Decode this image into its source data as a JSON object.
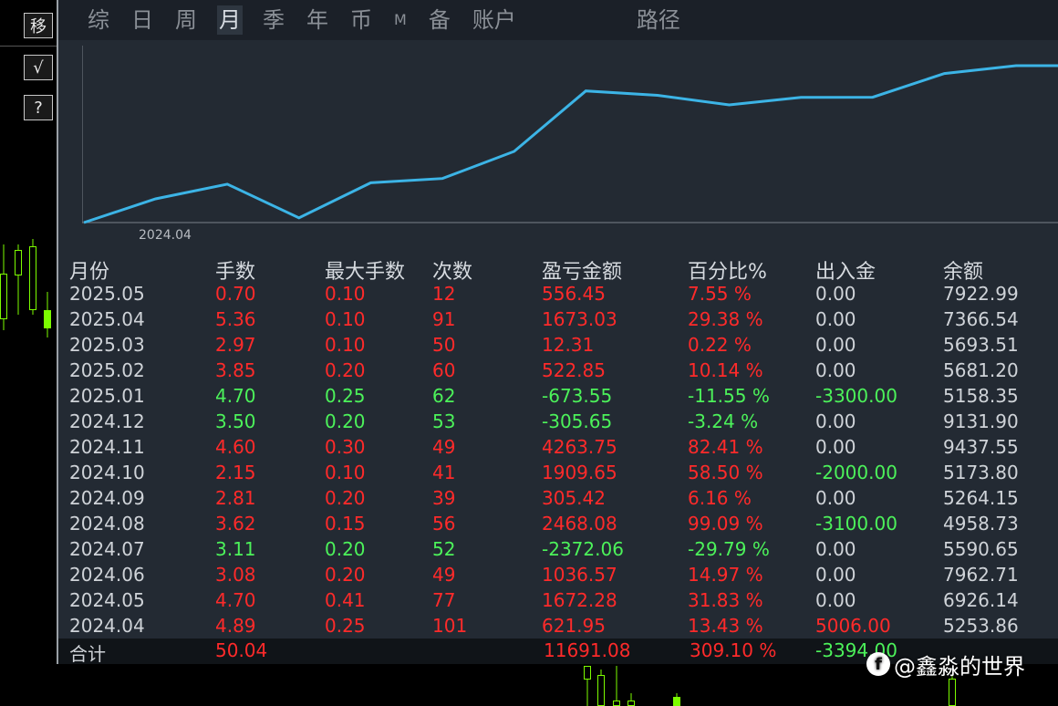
{
  "toolbar": {
    "move_label": "移",
    "check_label": "√",
    "help_label": "?"
  },
  "tabs": [
    {
      "label": "综"
    },
    {
      "label": "日"
    },
    {
      "label": "周"
    },
    {
      "label": "月"
    },
    {
      "label": "季"
    },
    {
      "label": "年"
    },
    {
      "label": "币"
    },
    {
      "label": "M"
    },
    {
      "label": "备"
    },
    {
      "label": "账户"
    },
    {
      "label": "路径"
    }
  ],
  "active_tab": "月",
  "chart_data": {
    "type": "line",
    "x": [
      "2024.04",
      "2024.05",
      "2024.06",
      "2024.07",
      "2024.08",
      "2024.09",
      "2024.10",
      "2024.11",
      "2024.12",
      "2025.01",
      "2025.02",
      "2025.03",
      "2025.04",
      "2025.05"
    ],
    "series": [
      {
        "values": [
          0,
          1672.28,
          2708.85,
          336.79,
          2804.87,
          3110.29,
          5019.94,
          9283.69,
          8978.04,
          8304.49,
          8827.34,
          8839.65,
          10512.68,
          11069.13
        ]
      }
    ],
    "x_tick_labels": [
      "2024.04"
    ],
    "line_color": "#3cb4e6"
  },
  "table": {
    "headers": [
      "月份",
      "手数",
      "最大手数",
      "次数",
      "盈亏金额",
      "百分比%",
      "出入金",
      "余额"
    ],
    "rows": [
      {
        "month": "2025.05",
        "lots": "0.70",
        "max_lots": "0.10",
        "count": "12",
        "pnl": "556.45",
        "pct": "7.55 %",
        "flow": "0.00",
        "balance": "7922.99",
        "sign": "pos",
        "flow_sign": "zero"
      },
      {
        "month": "2025.04",
        "lots": "5.36",
        "max_lots": "0.10",
        "count": "91",
        "pnl": "1673.03",
        "pct": "29.38 %",
        "flow": "0.00",
        "balance": "7366.54",
        "sign": "pos",
        "flow_sign": "zero"
      },
      {
        "month": "2025.03",
        "lots": "2.97",
        "max_lots": "0.10",
        "count": "50",
        "pnl": "12.31",
        "pct": "0.22 %",
        "flow": "0.00",
        "balance": "5693.51",
        "sign": "pos",
        "flow_sign": "zero"
      },
      {
        "month": "2025.02",
        "lots": "3.85",
        "max_lots": "0.20",
        "count": "60",
        "pnl": "522.85",
        "pct": "10.14 %",
        "flow": "0.00",
        "balance": "5681.20",
        "sign": "pos",
        "flow_sign": "zero"
      },
      {
        "month": "2025.01",
        "lots": "4.70",
        "max_lots": "0.25",
        "count": "62",
        "pnl": "-673.55",
        "pct": "-11.55 %",
        "flow": "-3300.00",
        "balance": "5158.35",
        "sign": "neg",
        "flow_sign": "neg"
      },
      {
        "month": "2024.12",
        "lots": "3.50",
        "max_lots": "0.20",
        "count": "53",
        "pnl": "-305.65",
        "pct": "-3.24 %",
        "flow": "0.00",
        "balance": "9131.90",
        "sign": "neg",
        "flow_sign": "zero"
      },
      {
        "month": "2024.11",
        "lots": "4.60",
        "max_lots": "0.30",
        "count": "49",
        "pnl": "4263.75",
        "pct": "82.41 %",
        "flow": "0.00",
        "balance": "9437.55",
        "sign": "pos",
        "flow_sign": "zero"
      },
      {
        "month": "2024.10",
        "lots": "2.15",
        "max_lots": "0.10",
        "count": "41",
        "pnl": "1909.65",
        "pct": "58.50 %",
        "flow": "-2000.00",
        "balance": "5173.80",
        "sign": "pos",
        "flow_sign": "neg"
      },
      {
        "month": "2024.09",
        "lots": "2.81",
        "max_lots": "0.20",
        "count": "39",
        "pnl": "305.42",
        "pct": "6.16 %",
        "flow": "0.00",
        "balance": "5264.15",
        "sign": "pos",
        "flow_sign": "zero"
      },
      {
        "month": "2024.08",
        "lots": "3.62",
        "max_lots": "0.15",
        "count": "56",
        "pnl": "2468.08",
        "pct": "99.09 %",
        "flow": "-3100.00",
        "balance": "4958.73",
        "sign": "pos",
        "flow_sign": "neg"
      },
      {
        "month": "2024.07",
        "lots": "3.11",
        "max_lots": "0.20",
        "count": "52",
        "pnl": "-2372.06",
        "pct": "-29.79 %",
        "flow": "0.00",
        "balance": "5590.65",
        "sign": "neg",
        "flow_sign": "zero"
      },
      {
        "month": "2024.06",
        "lots": "3.08",
        "max_lots": "0.20",
        "count": "49",
        "pnl": "1036.57",
        "pct": "14.97 %",
        "flow": "0.00",
        "balance": "7962.71",
        "sign": "pos",
        "flow_sign": "zero"
      },
      {
        "month": "2024.05",
        "lots": "4.70",
        "max_lots": "0.41",
        "count": "77",
        "pnl": "1672.28",
        "pct": "31.83 %",
        "flow": "0.00",
        "balance": "6926.14",
        "sign": "pos",
        "flow_sign": "zero"
      },
      {
        "month": "2024.04",
        "lots": "4.89",
        "max_lots": "0.25",
        "count": "101",
        "pnl": "621.95",
        "pct": "13.43 %",
        "flow": "5006.00",
        "balance": "5253.86",
        "sign": "pos",
        "flow_sign": "pos"
      }
    ],
    "total": {
      "label": "合计",
      "lots": "50.04",
      "pnl": "11691.08",
      "pct": "309.10 %",
      "flow": "-3394.00"
    }
  },
  "colors": {
    "positive": "#ff2a2a",
    "negative": "#4cf25a",
    "neutral": "#cfd3d8",
    "panel_bg": "#232a33",
    "candle": "#7cfc00"
  },
  "watermark": {
    "icon": "facebook-icon",
    "text": "@鑫淼的世界"
  }
}
